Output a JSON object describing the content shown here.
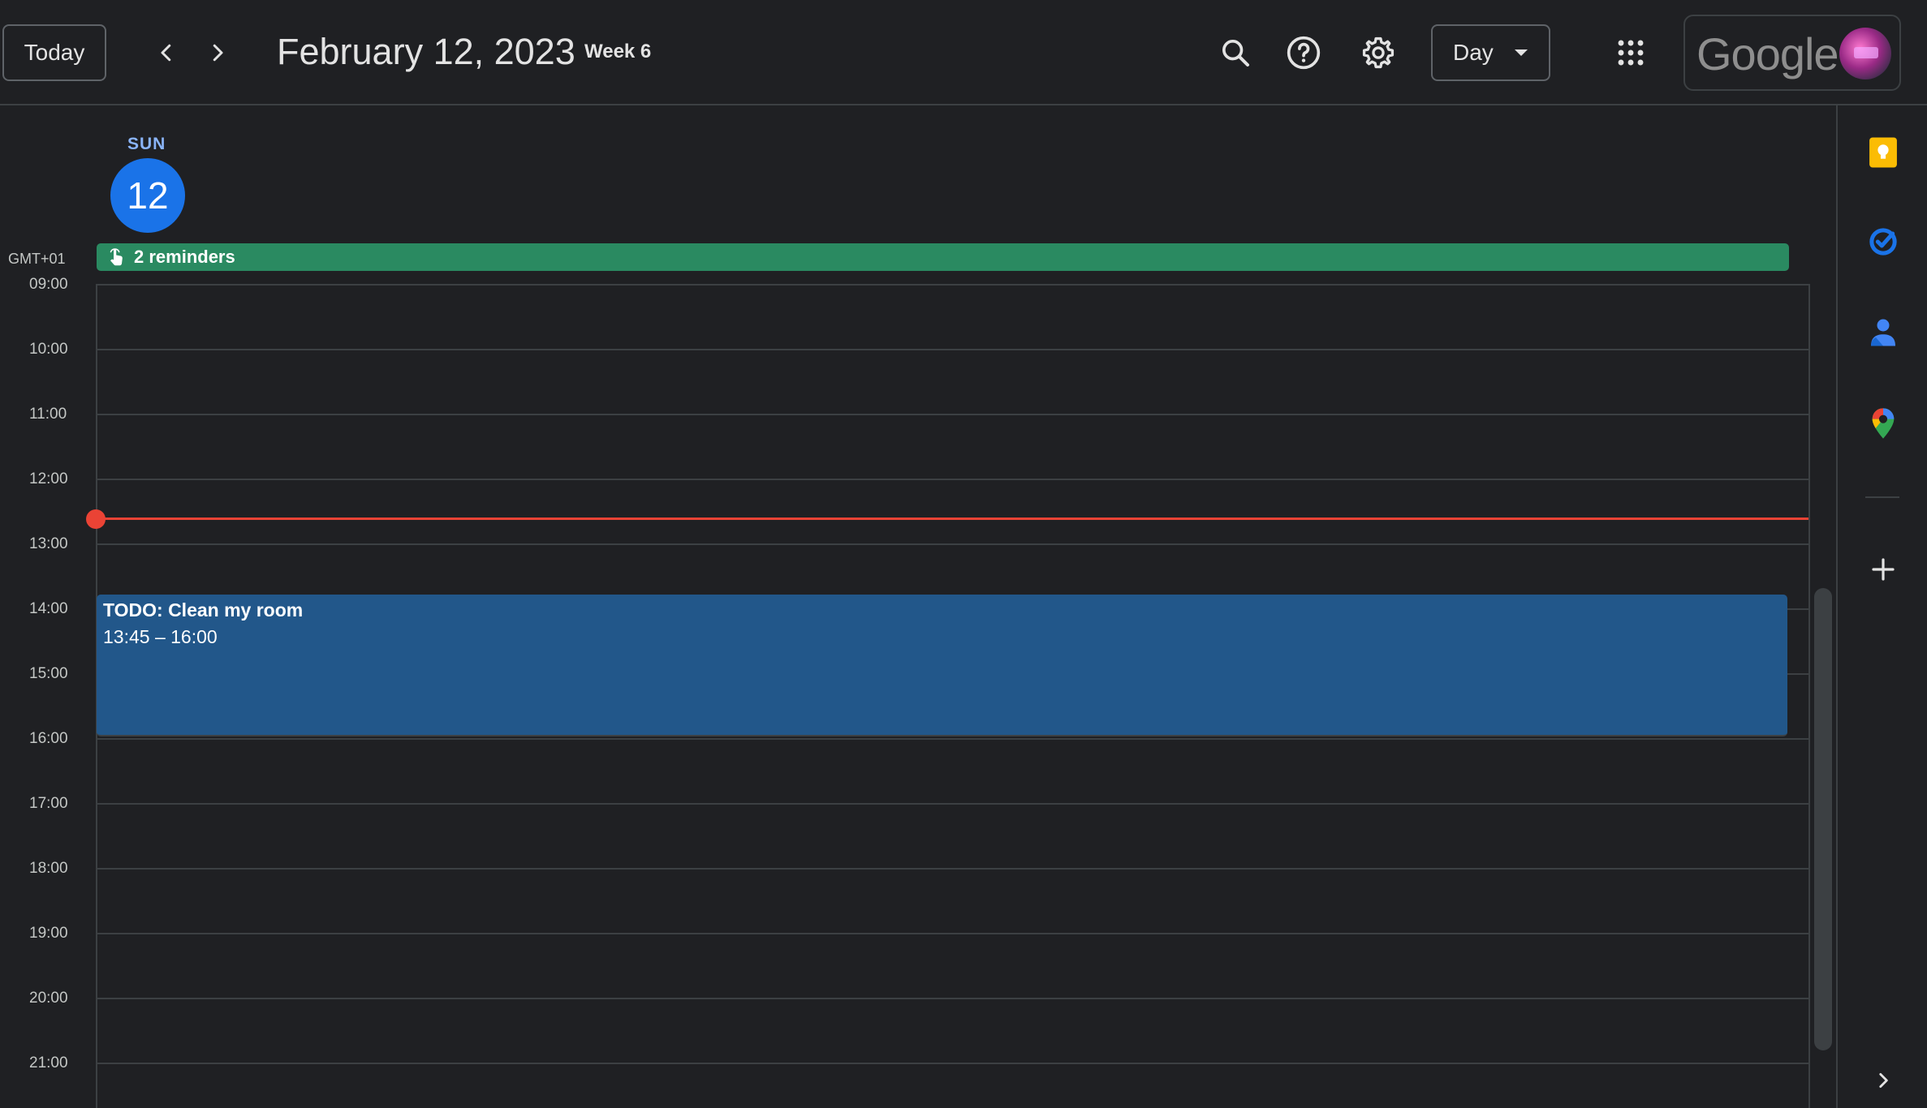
{
  "header": {
    "today_label": "Today",
    "date_title": "February 12, 2023",
    "week_label": "Week 6",
    "view_label": "Day",
    "account_logo_text": "Google"
  },
  "day": {
    "name": "SUN",
    "number": "12",
    "timezone": "GMT+01",
    "reminders_label": "2 reminders"
  },
  "hours": [
    "09:00",
    "10:00",
    "11:00",
    "12:00",
    "13:00",
    "14:00",
    "15:00",
    "16:00",
    "17:00",
    "18:00",
    "19:00",
    "20:00",
    "21:00"
  ],
  "event": {
    "title": "TODO: Clean my room",
    "time": "13:45 – 16:00",
    "color": "#22578a"
  },
  "colors": {
    "background": "#1f2023",
    "reminder": "#2a8a61",
    "current_time": "#ea4335",
    "today_circle": "#1a73e8"
  },
  "side_panel": {
    "icons": [
      "keep-icon",
      "tasks-icon",
      "contacts-icon",
      "maps-icon",
      "add-icon",
      "expand-icon"
    ]
  }
}
